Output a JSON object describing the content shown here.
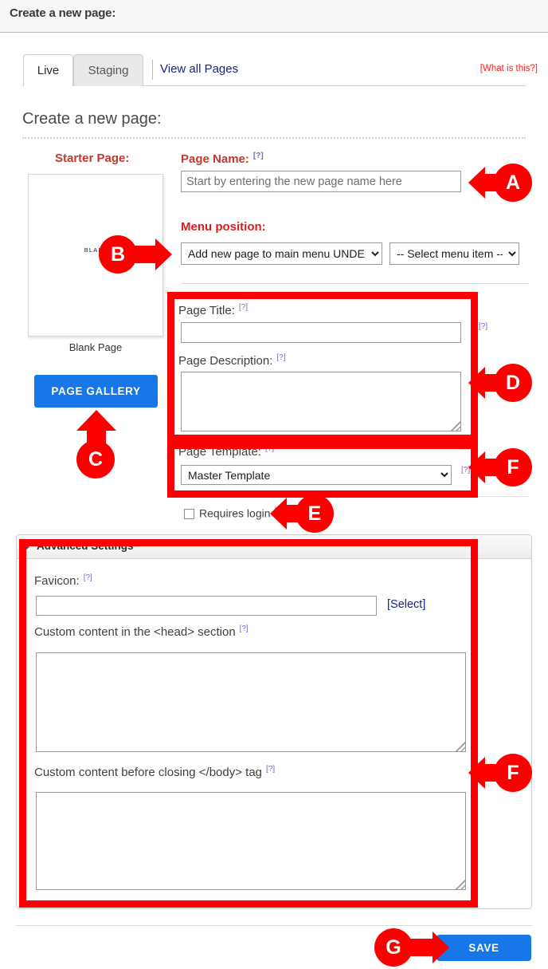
{
  "window": {
    "title": "Create a new page:"
  },
  "tabs": [
    {
      "label": "Live",
      "active": true
    },
    {
      "label": "Staging",
      "active": false
    }
  ],
  "links": {
    "view_all_pages": "View all Pages",
    "what_is_this": "[What is this?]",
    "favicon_select": "[Select]",
    "help_marker": "[?]"
  },
  "heading": "Create a new page:",
  "starter": {
    "label": "Starter Page:",
    "thumb_text": "BLANK",
    "caption": "Blank Page",
    "gallery_button": "PAGE GALLERY"
  },
  "fields": {
    "page_name": {
      "label": "Page Name:",
      "placeholder": "Start by entering the new page name here",
      "value": ""
    },
    "menu_position": {
      "label": "Menu position:",
      "select_primary": "Add new page to main menu UNDER:",
      "select_secondary": "-- Select menu item --"
    },
    "page_title": {
      "label": "Page Title:",
      "value": ""
    },
    "page_description": {
      "label": "Page Description:",
      "value": ""
    },
    "page_template": {
      "label": "Page Template:",
      "value": "Master Template"
    },
    "requires_login": {
      "label": "Requires login",
      "checked": false
    }
  },
  "advanced": {
    "title": "Advanced Settings",
    "favicon": {
      "label": "Favicon:",
      "value": ""
    },
    "head_content": {
      "label": "Custom content in the <head> section",
      "value": ""
    },
    "body_content": {
      "label": "Custom content before closing </body> tag",
      "value": ""
    }
  },
  "footer": {
    "save_label": "SAVE"
  },
  "annotations": [
    {
      "id": "A",
      "target": "page-name-input"
    },
    {
      "id": "B",
      "target": "starter-page-thumbnail"
    },
    {
      "id": "C",
      "target": "page-gallery-button"
    },
    {
      "id": "D",
      "target": "page-title-and-description"
    },
    {
      "id": "E",
      "target": "requires-login-checkbox"
    },
    {
      "id": "F",
      "target": "page-template-and-advanced-settings"
    },
    {
      "id": "G",
      "target": "save-button"
    }
  ],
  "colors": {
    "annotation_red": "#fb0000",
    "label_red": "#c0392b",
    "menu_label_red": "#e01b1b",
    "button_blue": "#1877e8",
    "link_blue": "#1a237e",
    "help_purple": "#7b68c8"
  }
}
